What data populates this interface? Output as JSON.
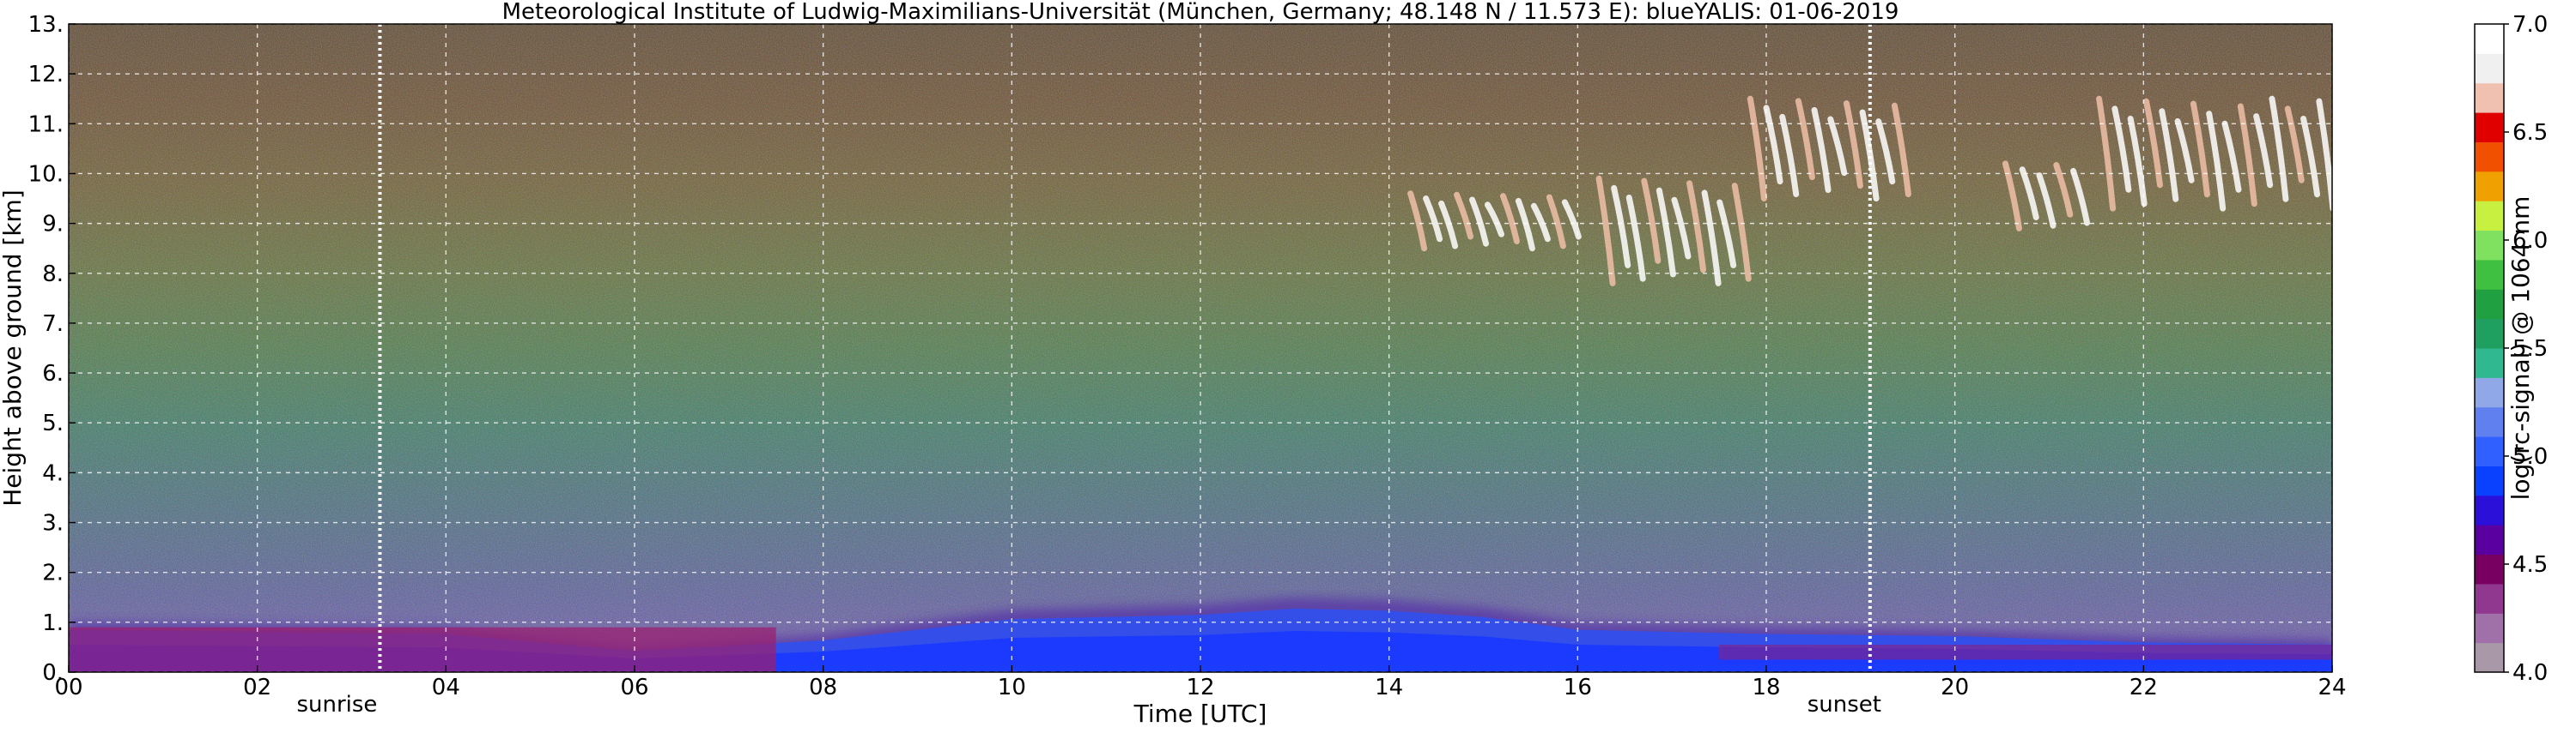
{
  "chart_data": {
    "type": "heatmap",
    "title": "Meteorological Institute of Ludwig-Maximilians-Universität (München, Germany; 48.148 N / 11.573 E):    blueYALIS: 01-06-2019",
    "xlabel": "Time [UTC]",
    "ylabel": "Height above ground [km]",
    "xlim": [
      0,
      24
    ],
    "ylim": [
      0,
      13
    ],
    "x_ticks": [
      0,
      2,
      4,
      6,
      8,
      10,
      12,
      14,
      16,
      18,
      20,
      22,
      24
    ],
    "x_tick_labels": [
      "00",
      "02",
      "04",
      "06",
      "08",
      "10",
      "12",
      "14",
      "16",
      "18",
      "20",
      "22",
      "24"
    ],
    "y_ticks": [
      0,
      1,
      2,
      3,
      4,
      5,
      6,
      7,
      8,
      9,
      10,
      11,
      12,
      13
    ],
    "y_tick_labels": [
      "0.",
      "1.",
      "2.",
      "3.",
      "4.",
      "5.",
      "6.",
      "7.",
      "8.",
      "9.",
      "10.",
      "11.",
      "12.",
      "13."
    ],
    "grid": true,
    "annotations": [
      {
        "text": "sunrise",
        "x": 3.3
      },
      {
        "text": "sunset",
        "x": 19.1
      }
    ],
    "colorbar": {
      "label": "log(rc-signal) @ 1064 nm",
      "range": [
        4.0,
        7.0
      ],
      "tick_values": [
        4.0,
        4.5,
        5.0,
        5.5,
        6.0,
        6.5,
        7.0
      ],
      "tick_labels": [
        "4.0",
        "4.5",
        "5.0",
        "5.5",
        "6.0",
        "6.5",
        "7.0"
      ],
      "colors": [
        "#a898a8",
        "#a070a8",
        "#903890",
        "#780060",
        "#5a00a0",
        "#2a10d8",
        "#0a40ff",
        "#3060ff",
        "#6080f0",
        "#90a8e8",
        "#30b890",
        "#20a060",
        "#20a040",
        "#40c040",
        "#80e060",
        "#c8f040",
        "#f0a000",
        "#f05000",
        "#e00000",
        "#f0c0b0",
        "#f0f0f0",
        "#ffffff"
      ]
    },
    "boundary_layer_height_km": [
      {
        "x": 0,
        "y": 1.0
      },
      {
        "x": 2,
        "y": 0.95
      },
      {
        "x": 4,
        "y": 0.9
      },
      {
        "x": 6,
        "y": 0.5
      },
      {
        "x": 8,
        "y": 0.75
      },
      {
        "x": 10,
        "y": 1.25
      },
      {
        "x": 12,
        "y": 1.35
      },
      {
        "x": 13,
        "y": 1.5
      },
      {
        "x": 14,
        "y": 1.45
      },
      {
        "x": 15,
        "y": 1.3
      },
      {
        "x": 16,
        "y": 1.0
      },
      {
        "x": 18,
        "y": 0.9
      },
      {
        "x": 20,
        "y": 0.85
      },
      {
        "x": 22,
        "y": 0.7
      },
      {
        "x": 24,
        "y": 0.65
      }
    ],
    "cirrus_clouds": [
      {
        "x_start": 14.2,
        "x_end": 16.0,
        "y_bottom": 8.5,
        "y_top": 9.6
      },
      {
        "x_start": 16.2,
        "x_end": 17.8,
        "y_bottom": 7.8,
        "y_top": 9.9
      },
      {
        "x_start": 17.8,
        "x_end": 19.5,
        "y_bottom": 9.5,
        "y_top": 11.5
      },
      {
        "x_start": 20.5,
        "x_end": 21.4,
        "y_bottom": 8.9,
        "y_top": 10.2
      },
      {
        "x_start": 21.5,
        "x_end": 24.0,
        "y_bottom": 9.3,
        "y_top": 11.5
      }
    ]
  }
}
